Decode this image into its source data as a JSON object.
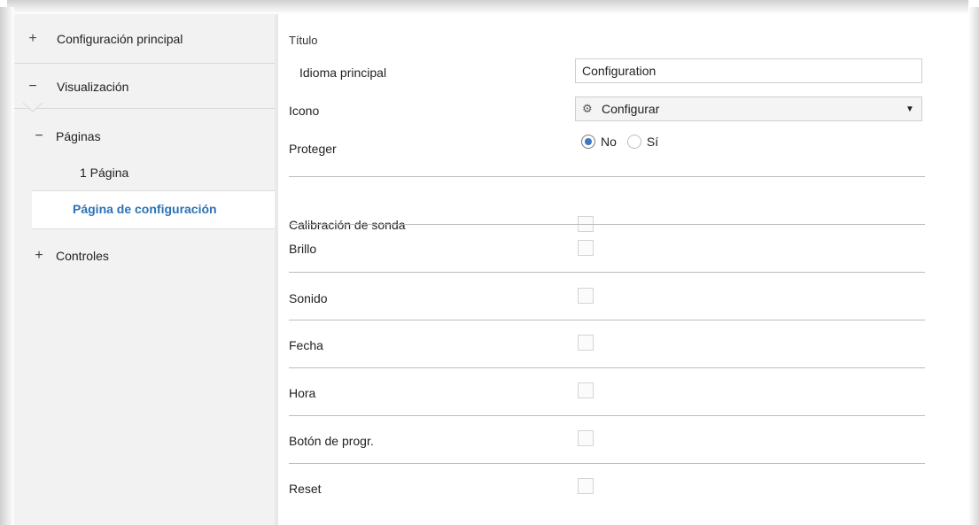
{
  "sidebar": {
    "items": [
      {
        "sign": "+",
        "label": "Configuración principal"
      },
      {
        "sign": "−",
        "label": "Visualización"
      },
      {
        "sign": "−",
        "label": "Páginas"
      },
      {
        "label": "1 Página"
      },
      {
        "label": "Página de configuración"
      },
      {
        "sign": "+",
        "label": "Controles"
      }
    ]
  },
  "main": {
    "section_title": "Título",
    "idioma_label": "Idioma principal",
    "idioma_value": "Configuration",
    "icono_label": "Icono",
    "icono_icon": "gear-icon",
    "icono_value": "Configurar",
    "proteger_label": "Proteger",
    "proteger_options": [
      {
        "label": "No",
        "checked": true
      },
      {
        "label": "Sí",
        "checked": false
      }
    ],
    "toggles": [
      {
        "label": "Calibración de sonda",
        "checked": false
      },
      {
        "label": "Brillo",
        "checked": false
      },
      {
        "label": "Sonido",
        "checked": false
      },
      {
        "label": "Fecha",
        "checked": false
      },
      {
        "label": "Hora",
        "checked": false
      },
      {
        "label": "Botón de progr.",
        "checked": false
      },
      {
        "label": "Reset",
        "checked": false
      }
    ]
  },
  "colors": {
    "accent": "#2b72b5",
    "radio_fill": "#3a78c3",
    "sidebar_bg": "#f2f2f2"
  }
}
